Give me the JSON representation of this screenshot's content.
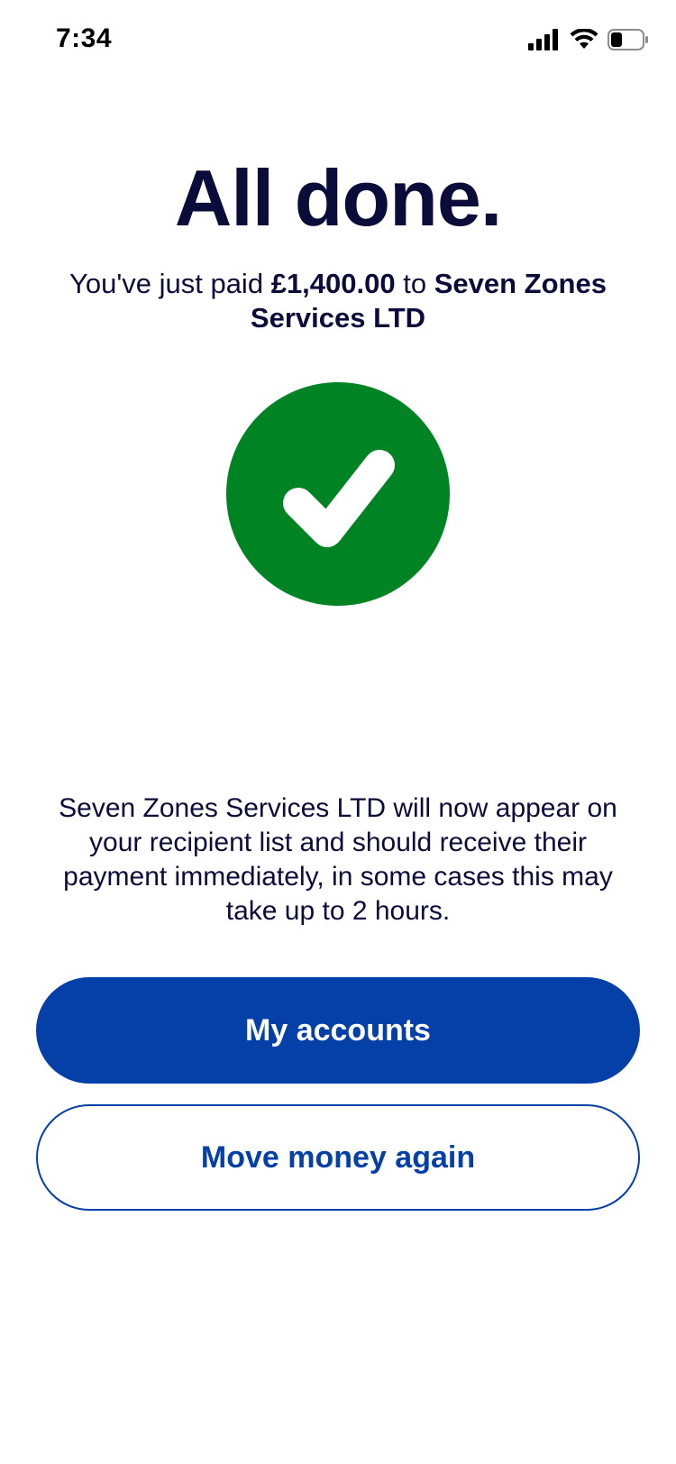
{
  "status_bar": {
    "time": "7:34",
    "icons": [
      "cellular-signal-icon",
      "wifi-icon",
      "battery-icon"
    ]
  },
  "title": "All done.",
  "confirmation": {
    "prefix": "You've just paid",
    "amount": "£1,400.00",
    "connector": "to",
    "recipient": "Seven Zones Services LTD"
  },
  "success_icon": "checkmark-circle-icon",
  "info_message": "Seven Zones Services LTD will now appear on your recipient list and should receive their payment immediately, in some cases this may take up to 2 hours.",
  "buttons": {
    "primary_label": "My accounts",
    "secondary_label": "Move money again"
  },
  "colors": {
    "success_green": "#008423",
    "brand_blue": "#0440a8",
    "text_navy": "#0b0c3a"
  }
}
